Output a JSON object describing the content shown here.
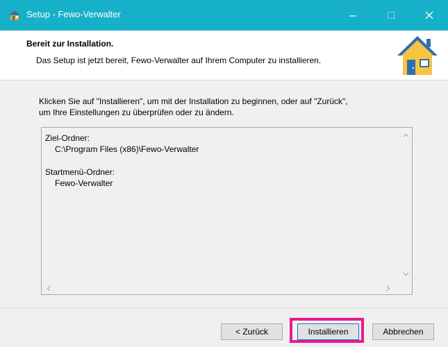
{
  "window": {
    "title": "Setup - Fewo-Verwalter",
    "minimize_glyph": "—",
    "close_glyph": "✕"
  },
  "header": {
    "title": "Bereit zur Installation.",
    "subtitle": "Das Setup ist jetzt bereit, Fewo-Verwalter auf Ihrem Computer zu installieren.",
    "icon": "house-icon"
  },
  "main": {
    "instruction_line1": "Klicken Sie auf \"Installieren\", um mit der Installation zu beginnen, oder auf \"Zurück\",",
    "instruction_line2": "um Ihre Einstellungen zu überprüfen oder zu ändern.",
    "memo": {
      "dest_label": "Ziel-Ordner:",
      "dest_value": "C:\\Program Files (x86)\\Fewo-Verwalter",
      "start_label": "Startmenü-Ordner:",
      "start_value": "Fewo-Verwalter"
    }
  },
  "buttons": {
    "back": "< Zurück",
    "install": "Installieren",
    "cancel": "Abbrechen"
  },
  "colors": {
    "titlebar": "#16b0c8",
    "highlight": "#e8198c"
  }
}
